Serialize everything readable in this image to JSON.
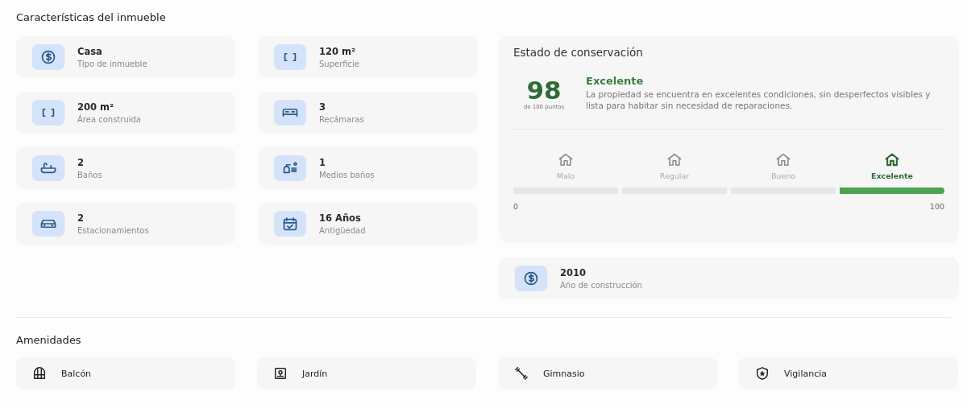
{
  "features_title": "Características del inmueble",
  "features": [
    {
      "value": "Casa",
      "label": "Tipo de inmueble"
    },
    {
      "value": "120 m²",
      "label": "Superficie"
    },
    {
      "value": "200 m²",
      "label": "Área construida"
    },
    {
      "value": "3",
      "label": "Recámaras"
    },
    {
      "value": "2",
      "label": "Baños"
    },
    {
      "value": "1",
      "label": "Medios baños"
    },
    {
      "value": "2",
      "label": "Estacionamientos"
    },
    {
      "value": "16 Años",
      "label": "Antigüedad"
    }
  ],
  "conservation": {
    "title": "Estado de conservación",
    "score": "98",
    "score_caption": "de 100 puntos",
    "rating": "Excelente",
    "description": "La propiedad se encuentra en excelentes condiciones, sin desperfectos visibles y lista para habitar sin necesidad de reparaciones.",
    "levels": [
      {
        "label": "Malo",
        "selected": false
      },
      {
        "label": "Regular",
        "selected": false
      },
      {
        "label": "Bueno",
        "selected": false
      },
      {
        "label": "Excelente",
        "selected": true
      }
    ],
    "scale_min": "0",
    "scale_max": "100"
  },
  "year": {
    "value": "2010",
    "label": "Año de construcción"
  },
  "amenities_title": "Amenidades",
  "amenities": [
    {
      "label": "Balcón"
    },
    {
      "label": "Jardín"
    },
    {
      "label": "Gimnasio"
    },
    {
      "label": "Vigilancia"
    }
  ]
}
